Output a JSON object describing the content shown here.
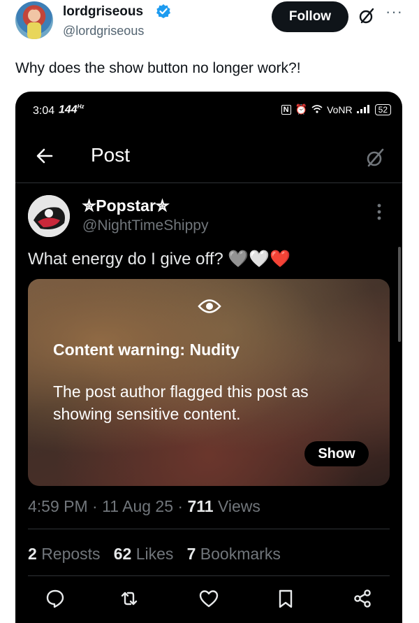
{
  "outer_tweet": {
    "display_name": "lordgriseous",
    "handle": "@lordgriseous",
    "follow_label": "Follow",
    "more_label": "···",
    "text": "Why does the show button no longer work?!"
  },
  "phone": {
    "status": {
      "time": "3:04",
      "refresh": "144",
      "refresh_unit": "Hz",
      "nfc": "N",
      "network": "VoNR",
      "battery": "52"
    },
    "header": {
      "title": "Post"
    },
    "post": {
      "display_name": "✮Popstar✮",
      "handle": "@NightTimeShippy",
      "text": "What energy do I give off? 🩶🤍❤️",
      "content_warning": {
        "title": "Content warning: Nudity",
        "body": "The post author flagged this post as showing sensitive content.",
        "show_label": "Show"
      },
      "time": "4:59 PM",
      "date": "11 Aug 25",
      "views_count": "711",
      "views_label": "Views",
      "reposts_count": "2",
      "reposts_label": "Reposts",
      "likes_count": "62",
      "likes_label": "Likes",
      "bookmarks_count": "7",
      "bookmarks_label": "Bookmarks"
    },
    "actions": [
      "reply-icon",
      "repost-icon",
      "like-icon",
      "bookmark-icon",
      "share-icon"
    ]
  },
  "colors": {
    "background": "#ffffff",
    "text_primary": "#0f1419",
    "text_secondary": "#536471",
    "verified": "#1d9bf0",
    "heart_red": "#f91880",
    "phone_bg": "#000000",
    "phone_muted": "#71767b"
  }
}
